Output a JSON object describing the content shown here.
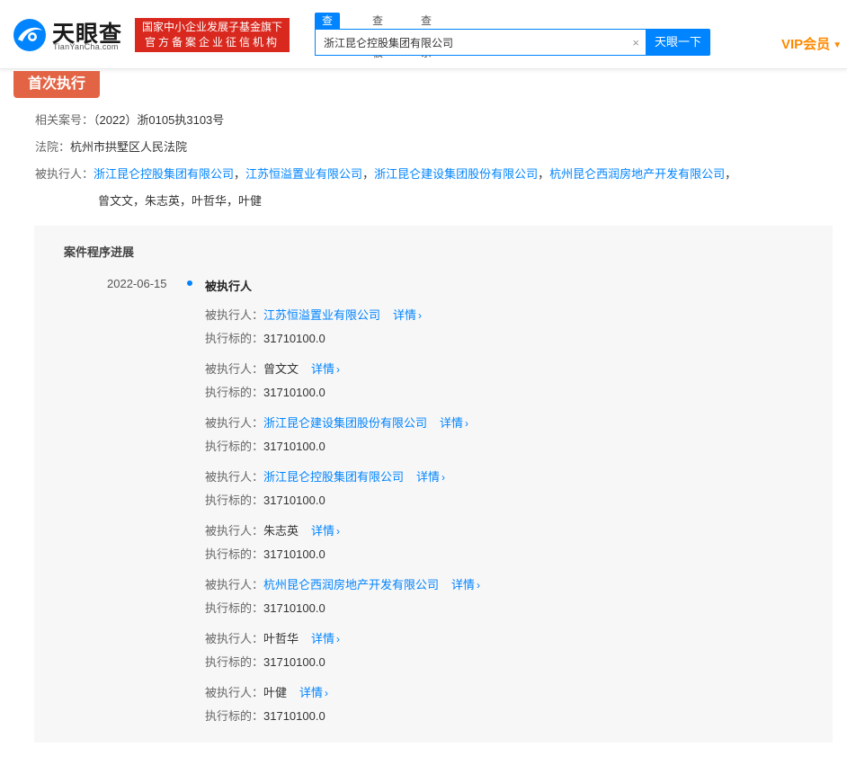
{
  "header": {
    "logo_text": "天眼查",
    "logo_sub": "TianYanCha.com",
    "badge_line1": "国家中小企业发展子基金旗下",
    "badge_line2": "官方备案企业征信机构",
    "tabs": [
      "查公司",
      "查老板",
      "查关系"
    ],
    "search_value": "浙江昆仑控股集团有限公司",
    "clear_icon": "×",
    "search_button": "天眼一下",
    "vip": "VIP会员",
    "vip_caret": "▼"
  },
  "section": {
    "title": "首次执行",
    "case_label": "相关案号：",
    "case_value": "（2022）浙0105执3103号",
    "court_label": "法院：",
    "court_value": "杭州市拱墅区人民法院",
    "parties_label": "被执行人：",
    "parties_linked": [
      "浙江昆仑控股集团有限公司",
      "江苏恒溢置业有限公司",
      "浙江昆仑建设集团股份有限公司",
      "杭州昆仑西润房地产开发有限公司"
    ],
    "parties_sep": "，",
    "parties_line2": "曾文文，朱志英，叶哲华，叶健"
  },
  "progress": {
    "title": "案件程序进展",
    "date": "2022-06-15",
    "event": "被执行人",
    "party_label": "被执行人：",
    "target_label": "执行标的：",
    "detail_label": "详情",
    "chevron": "›",
    "entries": [
      {
        "name": "江苏恒溢置业有限公司",
        "linked": true,
        "amount": "31710100.0"
      },
      {
        "name": "曾文文",
        "linked": false,
        "amount": "31710100.0"
      },
      {
        "name": "浙江昆仑建设集团股份有限公司",
        "linked": true,
        "amount": "31710100.0"
      },
      {
        "name": "浙江昆仑控股集团有限公司",
        "linked": true,
        "amount": "31710100.0"
      },
      {
        "name": "朱志英",
        "linked": false,
        "amount": "31710100.0"
      },
      {
        "name": "杭州昆仑西润房地产开发有限公司",
        "linked": true,
        "amount": "31710100.0"
      },
      {
        "name": "叶哲华",
        "linked": false,
        "amount": "31710100.0"
      },
      {
        "name": "叶健",
        "linked": false,
        "amount": "31710100.0"
      }
    ]
  },
  "colors": {
    "brand_blue": "#0084ff",
    "badge_red": "#d9281e",
    "tag_orange": "#e36445",
    "vip_orange": "#ff8a00"
  }
}
